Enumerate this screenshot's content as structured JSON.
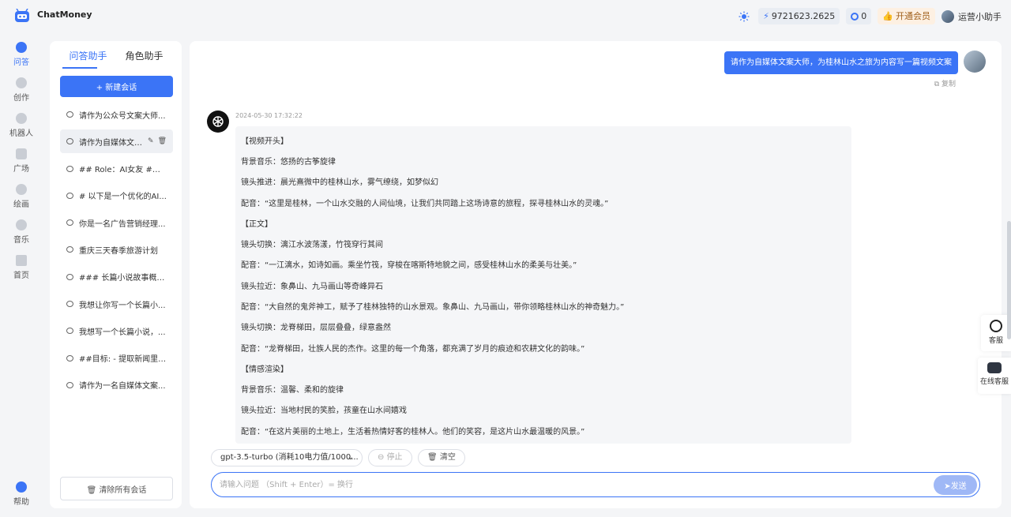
{
  "header": {
    "brand": "ChatMoney",
    "balance": "9721623.2625",
    "count": "0",
    "vip_label": "开通会员",
    "username": "运营小助手"
  },
  "rail": {
    "items": [
      {
        "label": "问答"
      },
      {
        "label": "创作"
      },
      {
        "label": "机器人"
      },
      {
        "label": "广场"
      },
      {
        "label": "绘画"
      },
      {
        "label": "音乐"
      },
      {
        "label": "首页"
      }
    ],
    "help": "帮助"
  },
  "sessions": {
    "tabs": [
      "问答助手",
      "角色助手"
    ],
    "new_button": "+ 新建会话",
    "items": [
      "请作为公众号文案大师...",
      "请作为自媒体文案...",
      "## Role：AI女友 ## Bac",
      "# 以下是一个优化的AI...",
      "你是一名广告营销经理...",
      "重庆三天春季旅游计划",
      "### 长篇小说故事概要...",
      "我想让你写一个长篇小...",
      "我想写一个长篇小说，...",
      "##目标: - 提取新闻里的...",
      "请作为一名自媒体文案..."
    ],
    "clear_all": "清除所有会话"
  },
  "chat": {
    "user_message": "请作为自媒体文案大师，为桂林山水之旅为内容写一篇视频文案",
    "copy_label": "复制",
    "timestamp": "2024-05-30 17:32:22",
    "answer_lines": [
      "【视频开头】",
      "背景音乐：悠扬的古筝旋律",
      "镜头推进：晨光熹微中的桂林山水，雾气缭绕，如梦似幻",
      "配音：“这里是桂林，一个山水交融的人间仙境，让我们共同踏上这场诗意的旅程，探寻桂林山水的灵魂。”",
      "【正文】",
      "镜头切换：漓江水波荡漾，竹筏穿行其间",
      "配音：“一江漓水，如诗如画。乘坐竹筏，穿梭在喀斯特地貌之间，感受桂林山水的柔美与壮美。”",
      "镜头拉近：象鼻山、九马画山等奇峰异石",
      "配音：“大自然的鬼斧神工，赋予了桂林独特的山水景观。象鼻山、九马画山，带你领略桂林山水的神奇魅力。”",
      "镜头切换：龙脊梯田，层层叠叠，绿意盎然",
      "配音：“龙脊梯田，壮族人民的杰作。这里的每一个角落，都充满了岁月的痕迹和农耕文化的韵味。”",
      "【情感渲染】",
      "背景音乐：温馨、柔和的旋律",
      "镜头拉近：当地村民的笑脸，孩童在山水间嬉戏",
      "配音：“在这片美丽的土地上，生活着热情好客的桂林人。他们的笑容，是这片山水最温暖的风景。”"
    ],
    "model": "gpt-3.5-turbo (消耗10电力值/1000...",
    "stop_label": "停止",
    "clear_label": "清空",
    "input_placeholder": "请输入问题 （Shift + Enter）= 换行",
    "send_label": "发送"
  },
  "float": {
    "service": "客服",
    "online_service": "在线客服"
  }
}
